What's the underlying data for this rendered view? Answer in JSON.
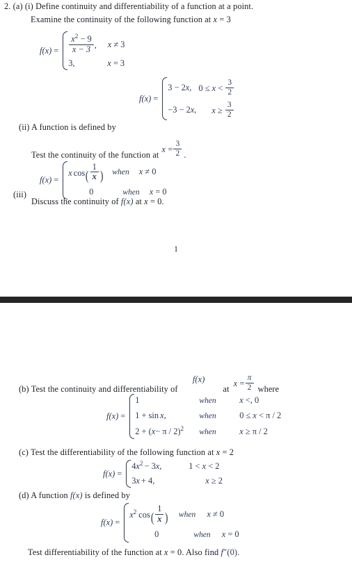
{
  "document": {
    "page_number": "1",
    "divider_color": "#262626",
    "text_color": "#1a1f27",
    "math_color": "#2b3a59"
  },
  "question": {
    "number": "2.",
    "part_a_label": "(a)",
    "item_i_label": "(i)",
    "item_ii_label": "(ii)",
    "item_iii_label": "(iii)",
    "part_b_label": "(b)",
    "part_c_label": "(c)",
    "part_d_label": "(d)"
  },
  "a_i": {
    "line1": "Define continuity and differentiability of a function at a point.",
    "line2_pre": "Examine the continuity of the following function at",
    "line2_var": "x",
    "line2_eq": "= 3",
    "eq1": {
      "lhs_f": "f",
      "lhs_x": "(x)",
      "lhs_eq": "=",
      "rows": [
        {
          "expr_num_var": "x",
          "expr_num_pow": "2",
          "expr_num_rest": "− 9",
          "expr_den": "x − 3",
          "comma": ",",
          "cond_var": "x",
          "cond_rest": "≠ 3"
        },
        {
          "expr": "3,",
          "cond_var": "x",
          "cond_rest": "= 3"
        }
      ]
    },
    "eq2": {
      "lhs_f": "f",
      "lhs_x": "(x)",
      "lhs_eq": "=",
      "rows": [
        {
          "expr_a": "3 − 2",
          "expr_var": "x",
          "expr_comma": ",",
          "cond_a": "0 ≤",
          "cond_var": "x",
          "cond_b": "<",
          "frac_num": "3",
          "frac_den": "2"
        },
        {
          "expr_a": "−3 − 2",
          "expr_var": "x",
          "expr_comma": ",",
          "cond_a": "",
          "cond_var": "x",
          "cond_b": "≥",
          "frac_num": "3",
          "frac_den": "2"
        }
      ]
    }
  },
  "a_ii": {
    "line1": "A function is defined by",
    "line2_pre": "Test the continuity of the function at",
    "line2_var": "x",
    "line2_eq": "=",
    "line2_frac_num": "3",
    "line2_frac_den": "2",
    "line2_post": ".",
    "eq": {
      "lhs_f": "f",
      "lhs_x": "(x)",
      "lhs_eq": "=",
      "rows": [
        {
          "expr_var": "x",
          "expr_fn": "cos",
          "frac_num": "1",
          "frac_den": "x",
          "when": "when",
          "cond_var": "x",
          "cond_rest": "≠ 0"
        },
        {
          "expr": "0",
          "when": "when",
          "cond_var": "x",
          "cond_rest": "= 0"
        }
      ]
    }
  },
  "a_iii": {
    "line_pre": "Discuss the continuity of",
    "line_f": "f",
    "line_fx": "(x)",
    "line_mid": "at",
    "line_var": "x",
    "line_post": "= 0."
  },
  "b": {
    "line_pre": "Test the continuity and differentiability of",
    "line_f": "f",
    "line_fx": "(x)",
    "line_at": "at",
    "line_var": "x",
    "line_eq": "=",
    "frac_num": "π",
    "frac_den": "2",
    "line_post": "where",
    "eq": {
      "lhs_f": "f",
      "lhs_x": "(x)",
      "lhs_eq": "=",
      "rows": [
        {
          "expr": "1",
          "when": "when",
          "cond_var": "x",
          "cond_rest": "<, 0"
        },
        {
          "expr_a": "1 + sin",
          "expr_var": "x",
          "expr_comma": ",",
          "when": "when",
          "cond_a": "0 ≤",
          "cond_var": "x",
          "cond_b": "< π / 2"
        },
        {
          "expr_a": "2 + (",
          "expr_var": "x",
          "expr_b": "− π / 2)",
          "expr_pow": "2",
          "when": "when",
          "cond_var": "x",
          "cond_rest": "≥ π / 2"
        }
      ]
    }
  },
  "c": {
    "line_pre": "Test the differentiability of the following function at",
    "line_var": "x",
    "line_post": "= 2",
    "eq": {
      "lhs_f": "f",
      "lhs_x": "(x)",
      "lhs_eq": "=",
      "rows": [
        {
          "expr_a": "4",
          "expr_var": "x",
          "expr_pow": "2",
          "expr_b": "− 3",
          "expr_var2": "x",
          "expr_comma": ",",
          "cond_a": "1 <",
          "cond_var": "x",
          "cond_b": "< 2"
        },
        {
          "expr_a": "3",
          "expr_var": "x",
          "expr_b": "+ 4,",
          "cond_var": "x",
          "cond_b": "≥ 2"
        }
      ]
    }
  },
  "d": {
    "line_pre": "A function",
    "line_f": "f",
    "line_fx": "(x)",
    "line_post": "is defined by",
    "eq": {
      "lhs_f": "f",
      "lhs_x": "(x)",
      "lhs_eq": "=",
      "rows": [
        {
          "expr_var": "x",
          "expr_pow": "2",
          "expr_fn": "cos",
          "frac_num": "1",
          "frac_den": "x",
          "when": "when",
          "cond_var": "x",
          "cond_rest": "≠ 0"
        },
        {
          "expr": "0",
          "when": "when",
          "cond_var": "x",
          "cond_rest": "= 0"
        }
      ]
    },
    "last_pre": "Test differentiability of the function at",
    "last_var": "x",
    "last_mid": "= 0. Also find",
    "last_f": "f",
    "last_prime": "″",
    "last_arg": "(0)."
  }
}
